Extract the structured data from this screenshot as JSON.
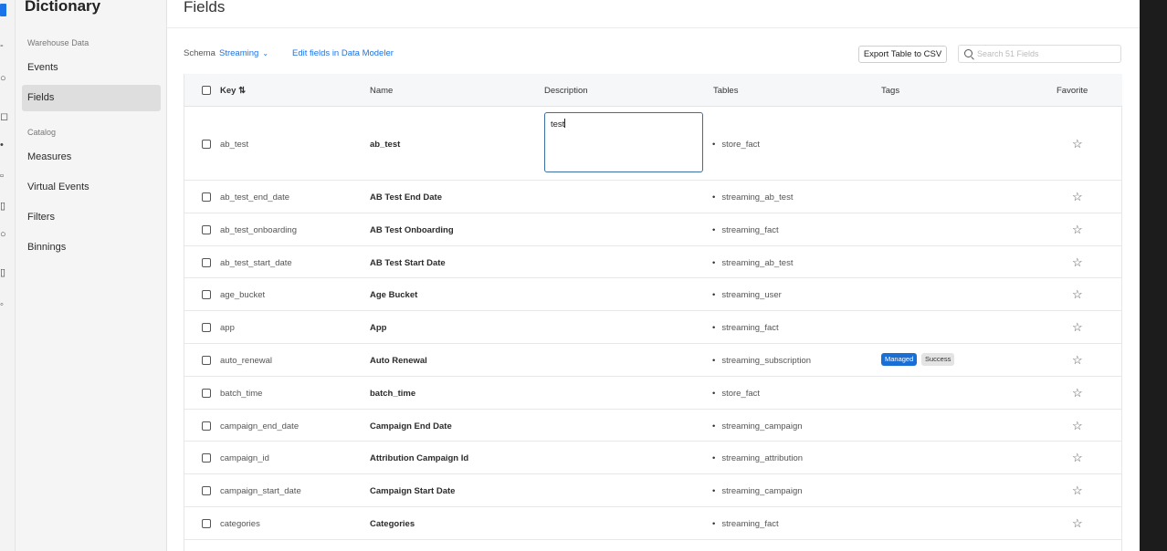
{
  "sidebar": {
    "title": "Dictionary",
    "sections": [
      {
        "label": "Warehouse Data",
        "items": [
          "Events",
          "Fields"
        ]
      },
      {
        "label": "Catalog",
        "items": [
          "Measures",
          "Virtual Events",
          "Filters",
          "Binnings"
        ]
      }
    ],
    "active_item": "Fields"
  },
  "page": {
    "title": "Fields"
  },
  "toolbar": {
    "schema_label": "Schema",
    "schema_value": "Streaming",
    "edit_link": "Edit fields in Data Modeler",
    "export_label": "Export Table to CSV",
    "search_placeholder": "Search 51 Fields"
  },
  "table": {
    "columns": [
      "Key",
      "Name",
      "Description",
      "Tables",
      "Tags",
      "Favorite"
    ],
    "sort_indicator": "⇅",
    "rows": [
      {
        "key": "ab_test",
        "name": "ab_test",
        "description": "test",
        "table": "store_fact"
      },
      {
        "key": "ab_test_end_date",
        "name": "AB Test End Date",
        "table": "streaming_ab_test"
      },
      {
        "key": "ab_test_onboarding",
        "name": "AB Test Onboarding",
        "table": "streaming_fact"
      },
      {
        "key": "ab_test_start_date",
        "name": "AB Test Start Date",
        "table": "streaming_ab_test"
      },
      {
        "key": "age_bucket",
        "name": "Age Bucket",
        "table": "streaming_user"
      },
      {
        "key": "app",
        "name": "App",
        "table": "streaming_fact"
      },
      {
        "key": "auto_renewal",
        "name": "Auto Renewal",
        "table": "streaming_subscription",
        "tags": [
          "Managed",
          "Success"
        ]
      },
      {
        "key": "batch_time",
        "name": "batch_time",
        "table": "store_fact"
      },
      {
        "key": "campaign_end_date",
        "name": "Campaign End Date",
        "table": "streaming_campaign"
      },
      {
        "key": "campaign_id",
        "name": "Attribution Campaign Id",
        "table": "streaming_attribution"
      },
      {
        "key": "campaign_start_date",
        "name": "Campaign Start Date",
        "table": "streaming_campaign"
      },
      {
        "key": "categories",
        "name": "Categories",
        "table": "streaming_fact"
      }
    ]
  },
  "icons": {
    "favorite": "star-outline-icon",
    "search": "search-icon",
    "checkbox": "checkbox-icon",
    "sort": "sort-icon"
  },
  "colors": {
    "accent": "#1a73e8",
    "managed_tag": "#1a6fd6"
  }
}
